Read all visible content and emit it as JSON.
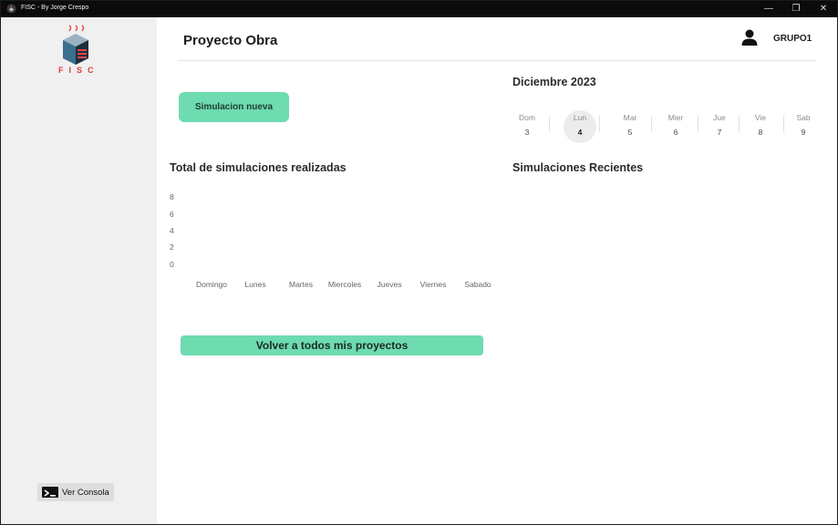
{
  "window": {
    "title": "FISC - By Jorge Crespo"
  },
  "sidebar": {
    "logo_text": "FISC",
    "console_label": "Ver Consola"
  },
  "header": {
    "title": "Proyecto Obra",
    "user": "GRUPO1"
  },
  "actions": {
    "new_simulation": "Simulacion nueva",
    "back_to_projects": "Volver a todos mis proyectos"
  },
  "calendar": {
    "title": "Diciembre 2023",
    "selected_index": 1,
    "days": [
      {
        "name": "Dom",
        "date": "3"
      },
      {
        "name": "Lun",
        "date": "4"
      },
      {
        "name": "Mar",
        "date": "5"
      },
      {
        "name": "Mier",
        "date": "6"
      },
      {
        "name": "Jue",
        "date": "7"
      },
      {
        "name": "Vie",
        "date": "8"
      },
      {
        "name": "Sab",
        "date": "9"
      }
    ]
  },
  "recent": {
    "title": "Simulaciones Recientes"
  },
  "chart_data": {
    "type": "bar",
    "title": "Total de simulaciones realizadas",
    "categories": [
      "Domingo",
      "Lunes",
      "Martes",
      "Miercoles",
      "Jueves",
      "Viernes",
      "Sabado"
    ],
    "values": [
      0,
      0,
      0,
      0,
      0,
      0,
      0
    ],
    "yticks": [
      "8",
      "6",
      "4",
      "2",
      "0"
    ],
    "ylim": [
      0,
      8
    ],
    "xlabel": "",
    "ylabel": "",
    "grid": false,
    "bar_color": "#6edbb0"
  }
}
